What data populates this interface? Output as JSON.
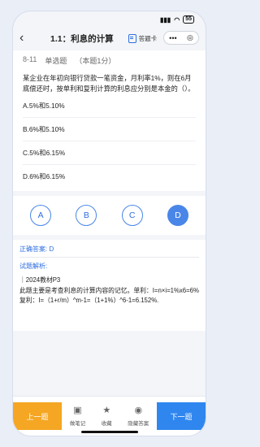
{
  "status": {
    "time": "",
    "signal": "📶",
    "wifi": "",
    "battery": "55"
  },
  "navbar": {
    "back": "‹",
    "title": "1.1：利息的计算",
    "answer_sheet_label": "答题卡",
    "menu_dots": "•••",
    "close_glyph": "◎"
  },
  "question": {
    "index": "8-11",
    "type": "单选题",
    "score": "（本题1分）",
    "text": "某企业在年初向银行贷款一笔资金，月利率1%，则在6月底偿还时，按单利和复利计算的利息应分别是本金的（）。",
    "options": [
      {
        "label": "A.5%和5.10%"
      },
      {
        "label": "B.6%和5.10%"
      },
      {
        "label": "C.5%和6.15%"
      },
      {
        "label": "D.6%和6.15%"
      }
    ]
  },
  "choices": [
    "A",
    "B",
    "C",
    "D"
  ],
  "selected_choice": "D",
  "analysis": {
    "answer": "正确答案: D",
    "title": "试题解析:",
    "body": "｜2024教材P3\n此题主要是考查利息的计算内容的记忆。单利：I=n×i=1%x6=6%复利：I=（1+r/m）^m-1=（1+1%）^6-1=6.152%."
  },
  "toolbar": {
    "prev": "上一题",
    "next": "下一题",
    "tools": [
      {
        "icon": "note-icon",
        "glyph": "▣",
        "label": "做笔记"
      },
      {
        "icon": "star-icon",
        "glyph": "★",
        "label": "收藏"
      },
      {
        "icon": "eye-icon",
        "glyph": "◉",
        "label": "隐藏答案"
      }
    ]
  },
  "colors": {
    "accent": "#2f86ef",
    "prev": "#f5a623",
    "choice_border": "#4a86e8"
  }
}
